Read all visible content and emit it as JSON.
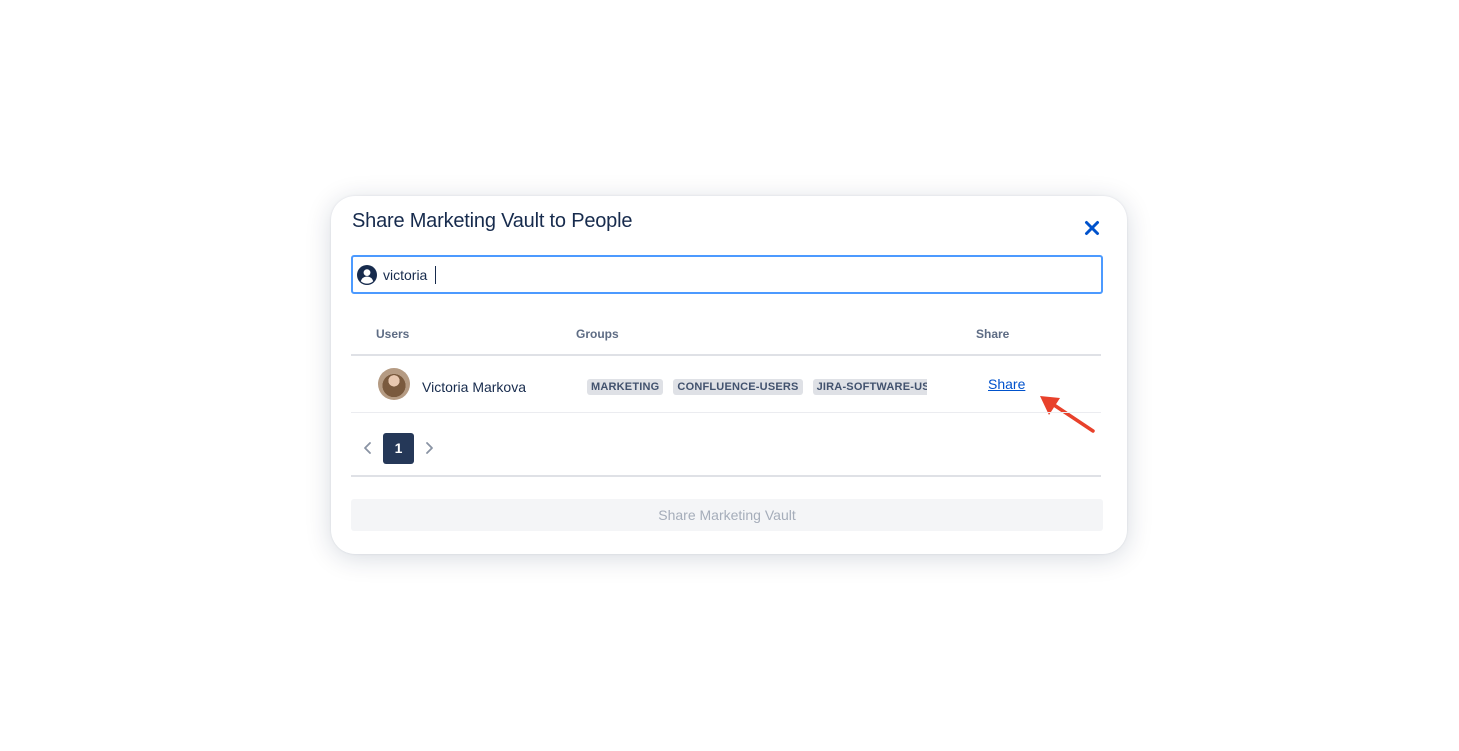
{
  "dialog": {
    "title": "Share Marketing Vault to People",
    "search": {
      "value": "victoria",
      "placeholder": ""
    },
    "table": {
      "headers": {
        "users": "Users",
        "groups": "Groups",
        "share": "Share"
      },
      "rows": [
        {
          "user_name": "Victoria Markova",
          "groups": [
            "MARKETING",
            "CONFLUENCE-USERS",
            "JIRA-SOFTWARE-USERS"
          ],
          "action": "Share"
        }
      ]
    },
    "pagination": {
      "current_page": "1"
    },
    "submit_label": "Share Marketing Vault"
  },
  "colors": {
    "accent": "#0052cc",
    "focus_border": "#4c9aff",
    "title_text": "#172b4d",
    "annotation_arrow": "#e8412b"
  },
  "icons": {
    "close": "close-icon",
    "search": "user-circle-icon",
    "prev": "chevron-left-icon",
    "next": "chevron-right-icon"
  }
}
